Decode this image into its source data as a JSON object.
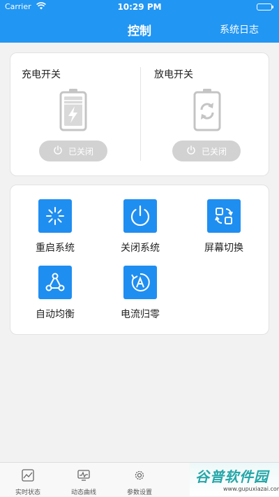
{
  "status_bar": {
    "carrier": "Carrier",
    "time": "10:29 PM"
  },
  "nav": {
    "title": "控制",
    "right_action": "系统日志"
  },
  "switches": [
    {
      "label": "充电开关",
      "state": "已关闭",
      "icon": "battery-charging-icon"
    },
    {
      "label": "放电开关",
      "state": "已关闭",
      "icon": "battery-cycle-icon"
    }
  ],
  "actions": [
    {
      "label": "重启系统",
      "icon": "restart-spinner-icon"
    },
    {
      "label": "关闭系统",
      "icon": "power-icon"
    },
    {
      "label": "屏幕切换",
      "icon": "screen-switch-icon"
    },
    {
      "label": "自动均衡",
      "icon": "triangle-nodes-icon"
    },
    {
      "label": "电流归零",
      "icon": "reset-a-icon"
    }
  ],
  "tabs": [
    {
      "label": "实时状态",
      "icon": "realtime-chart-icon"
    },
    {
      "label": "动态曲线",
      "icon": "monitor-curve-icon"
    },
    {
      "label": "参数设置",
      "icon": "gear-icon"
    }
  ],
  "watermark": {
    "name": "谷普软件园",
    "url": "www.gupuxiazai.com"
  },
  "colors": {
    "accent": "#2196f3",
    "icon_tile": "#1f8ef1",
    "disabled_button": "#d2d2d2"
  }
}
